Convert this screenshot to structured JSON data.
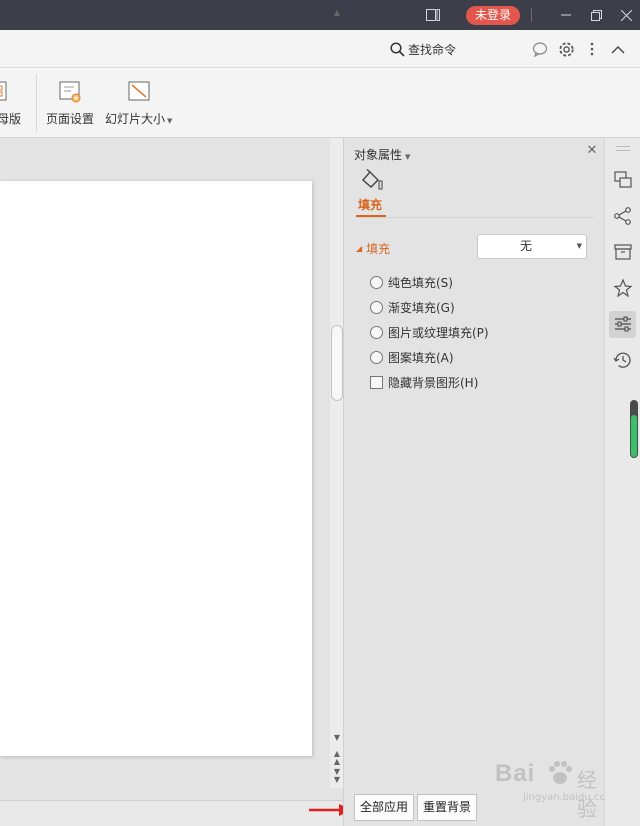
{
  "titlebar": {
    "login_label": "未登录",
    "icons": [
      "window-icon",
      "minimize-icon",
      "restore-icon",
      "close-icon"
    ]
  },
  "command_bar": {
    "search_label": "查找命令",
    "icons": [
      "chat-icon",
      "gear-icon",
      "more-icon",
      "collapse-icon"
    ]
  },
  "ribbon": {
    "items": [
      {
        "label": "母版",
        "icon": "master-slide-icon"
      },
      {
        "label": "页面设置",
        "icon": "page-setup-icon"
      },
      {
        "label": "幻灯片大小",
        "icon": "slide-size-icon",
        "has_dropdown": true
      }
    ]
  },
  "panel": {
    "title": "对象属性",
    "tab_label": "填充",
    "section_label": "填充",
    "fill_select_value": "无",
    "options": [
      {
        "label": "纯色填充(S)",
        "type": "radio",
        "checked": false
      },
      {
        "label": "渐变填充(G)",
        "type": "radio",
        "checked": false
      },
      {
        "label": "图片或纹理填充(P)",
        "type": "radio",
        "checked": false
      },
      {
        "label": "图案填充(A)",
        "type": "radio",
        "checked": false
      },
      {
        "label": "隐藏背景图形(H)",
        "type": "checkbox",
        "checked": false
      }
    ],
    "apply_all_label": "全部应用",
    "reset_bg_label": "重置背景"
  },
  "sidebar": {
    "icons": [
      "slides-icon",
      "share-icon",
      "archive-icon",
      "animation-icon",
      "properties-icon",
      "history-icon"
    ],
    "active_index": 4,
    "level_percent": 75
  },
  "watermark": {
    "brand": "Bai",
    "brand_suffix": "经验",
    "url": "jingyan.baidu.com"
  },
  "colors": {
    "accent": "#d9651f",
    "login_bg": "#e2564c",
    "titlebar_bg": "#3c3f4a",
    "arrow": "#e02020"
  }
}
